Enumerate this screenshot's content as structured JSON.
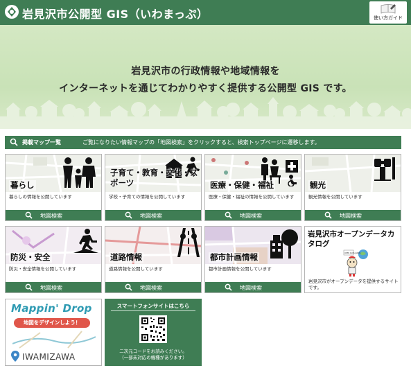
{
  "header": {
    "title": "岩見沢市公開型 GIS（いわまっぷ）",
    "guide_label": "使い方ガイド"
  },
  "hero": {
    "line1": "岩見沢市の行政情報や地域情報を",
    "line2": "インターネットを通じてわかりやすく提供する公開型 GIS です。"
  },
  "map_list": {
    "label": "掲載マップ一覧",
    "description": "ご覧になりたい情報マップの「地図検索」をクリックすると、検索トップページに遷移します。"
  },
  "search_label": "地図検索",
  "cards": [
    {
      "title": "暮らし",
      "desc": "暮らしの情報を公開しています",
      "icon": "family-icon"
    },
    {
      "title": "子育て・教育・文化・スポーツ",
      "desc": "学校・子育ての情報を公開しています",
      "icon": "runner-icon"
    },
    {
      "title": "医療・保健・福祉",
      "desc": "医療・保健・福祉の情報を公開しています",
      "icon": "medical-icon"
    },
    {
      "title": "観光",
      "desc": "観光情報を公開しています",
      "icon": "binoculars-icon"
    },
    {
      "title": "防災・安全",
      "desc": "防災・安全情報を公開しています",
      "icon": "evacuation-icon"
    },
    {
      "title": "道路情報",
      "desc": "道路情報を公開しています",
      "icon": "road-icon"
    },
    {
      "title": "都市計画情報",
      "desc": "都市計画情報を公開しています",
      "icon": "city-icon"
    }
  ],
  "open_data": {
    "title": "岩見沢市オープンデータカタログ",
    "desc": "岩見沢市がオープンデータを提供するサイトです。",
    "badge": "OPEN DATA JAPAN"
  },
  "mappin": {
    "title": "Mappin' Drop",
    "tagline": "地図をデザインしよう！",
    "city": "IWAMIZAWA"
  },
  "smartphone": {
    "title": "スマートフォンサイトはこちら",
    "note1": "二次元コードをお読みください。",
    "note2": "（一部未対応の機種があります）"
  },
  "colors": {
    "brand_green": "#3f7d54",
    "hero_green": "#c9e2b7",
    "border": "#b5b5b5"
  }
}
